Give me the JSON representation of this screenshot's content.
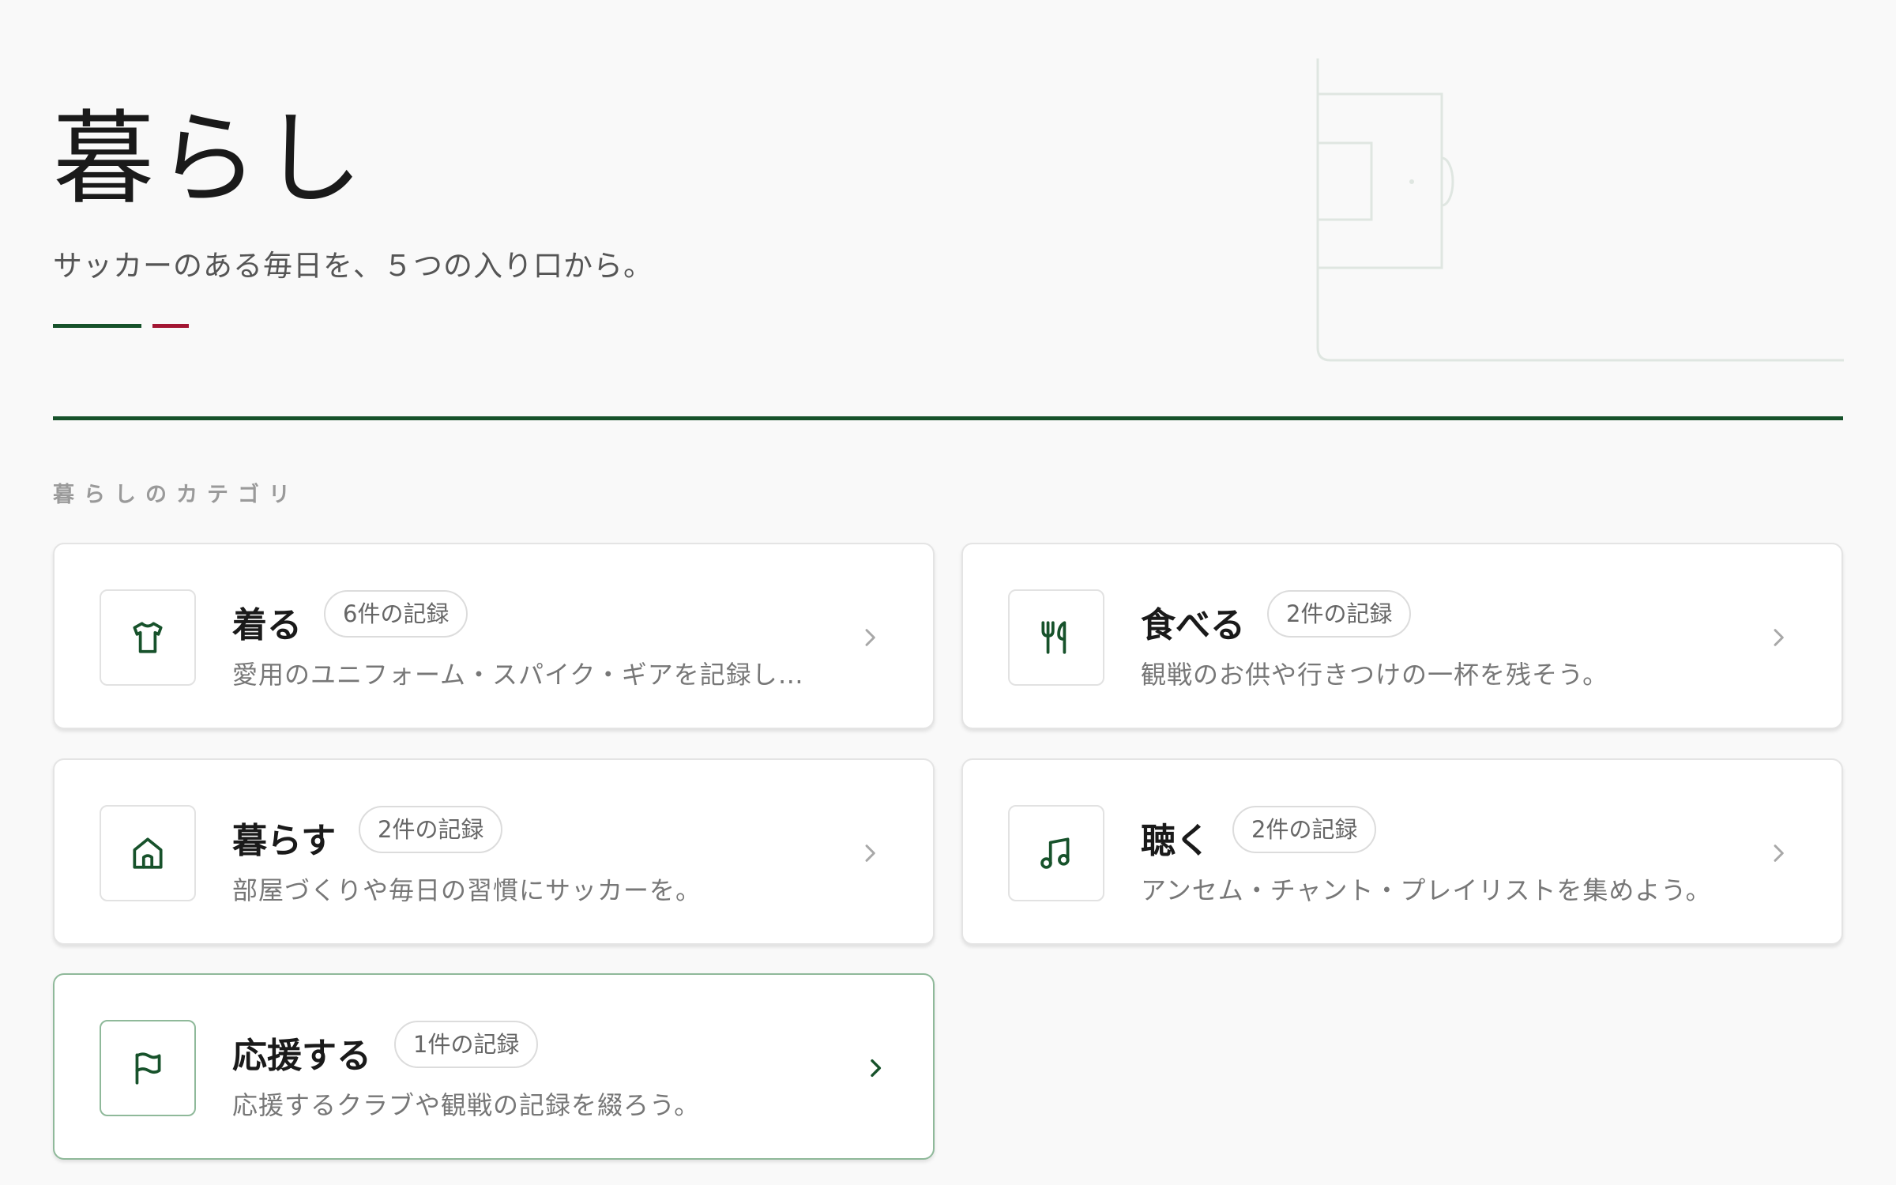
{
  "header": {
    "title": "暮らし",
    "subtitle": "サッカーのある毎日を、５つの入り口から。"
  },
  "section": {
    "label": "暮らしのカテゴリ"
  },
  "colors": {
    "accent_green": "#17522b",
    "accent_red": "#a31633",
    "background": "#f9f9f9"
  },
  "categories": [
    {
      "title": "着る",
      "badge": "6件の記録",
      "description": "愛用のユニフォーム・スパイク・ギアを記録し…",
      "icon": "shirt-icon"
    },
    {
      "title": "食べる",
      "badge": "2件の記録",
      "description": "観戦のお供や行きつけの一杯を残そう。",
      "icon": "fork-knife-icon"
    },
    {
      "title": "暮らす",
      "badge": "2件の記録",
      "description": "部屋づくりや毎日の習慣にサッカーを。",
      "icon": "home-icon"
    },
    {
      "title": "聴く",
      "badge": "2件の記録",
      "description": "アンセム・チャント・プレイリストを集めよう。",
      "icon": "music-note-icon"
    },
    {
      "title": "応援する",
      "badge": "1件の記録",
      "description": "応援するクラブや観戦の記録を綴ろう。",
      "icon": "flag-icon"
    }
  ]
}
